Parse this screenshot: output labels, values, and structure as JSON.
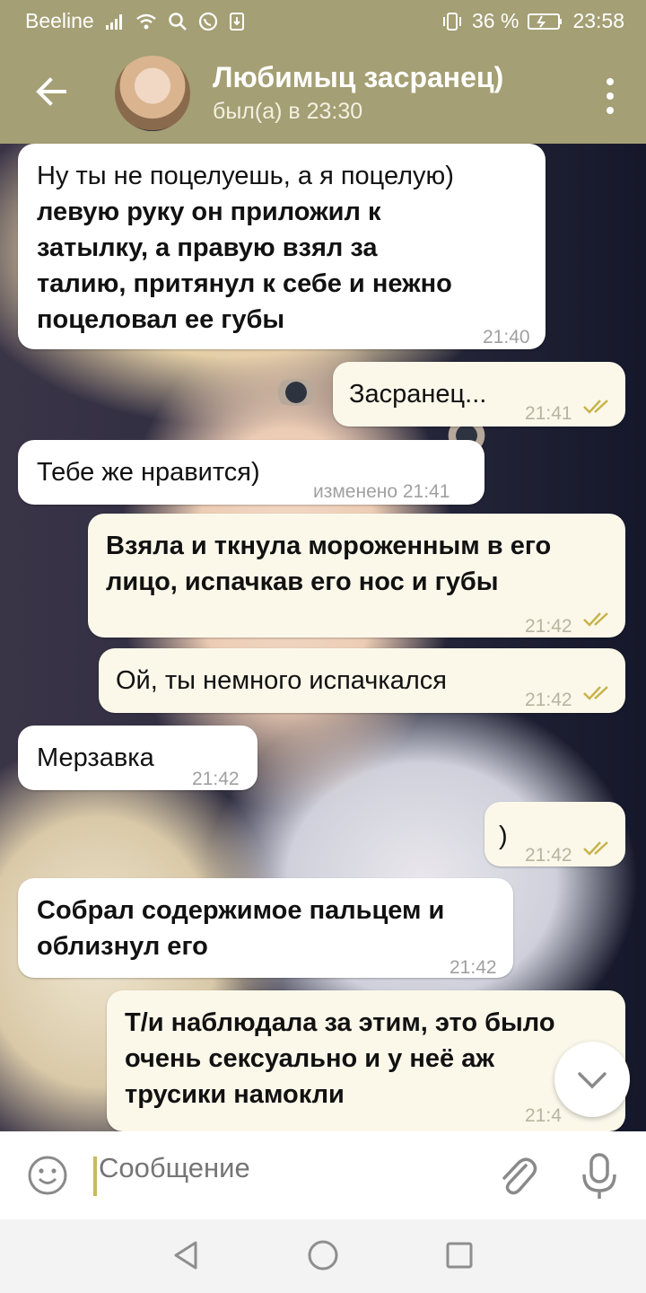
{
  "status_bar": {
    "carrier": "Beeline",
    "battery_percent": "36 %",
    "clock": "23:58",
    "icons": [
      "signal-icon",
      "wifi-icon",
      "search-icon",
      "whatsapp-icon",
      "download-icon",
      "vibrate-icon",
      "battery-icon"
    ]
  },
  "header": {
    "contact_name": "Любимыц засранец)",
    "last_seen": "был(а) в 23:30",
    "colors": {
      "bar": "#a49f74"
    }
  },
  "messages": [
    {
      "direction": "in",
      "bold": false,
      "lines": [
        "Ну ты не поцелуешь, а я поцелую)"
      ],
      "time": "21:40"
    },
    {
      "direction": "in",
      "bold": true,
      "lines": [
        "левую руку он приложил к",
        "затылку, а правую взял за",
        "талию, притянул к себе и нежно",
        "поцеловал ее губы"
      ]
    },
    {
      "direction": "out",
      "bold": false,
      "lines": [
        "Засранец..."
      ],
      "time": "21:41",
      "read": true
    },
    {
      "direction": "in",
      "bold": false,
      "lines": [
        "Тебе же нравится)"
      ],
      "time": "изменено 21:41"
    },
    {
      "direction": "out",
      "bold": true,
      "lines": [
        "Взяла и ткнула мороженным в его",
        "лицо, испачкав его нос и губы"
      ],
      "time": "21:42",
      "read": true
    },
    {
      "direction": "out",
      "bold": false,
      "lines": [
        "Ой, ты немного испачкался"
      ],
      "time": "21:42",
      "read": true
    },
    {
      "direction": "in",
      "bold": false,
      "lines": [
        "Мерзавка"
      ],
      "time": "21:42"
    },
    {
      "direction": "out",
      "bold": false,
      "lines": [
        ")"
      ],
      "time": "21:42",
      "read": true
    },
    {
      "direction": "in",
      "bold": true,
      "lines": [
        "Собрал содержимое пальцем и",
        "облизнул его"
      ],
      "time": "21:42"
    },
    {
      "direction": "out",
      "bold": true,
      "lines": [
        "Т/и наблюдала за этим, это было",
        "очень сексуально и у неё аж",
        "трусики намокли"
      ],
      "time": "21:4"
    }
  ],
  "composer": {
    "placeholder": "Сообщение"
  },
  "colors": {
    "incoming_bubble": "#ffffff",
    "outgoing_bubble": "#fbf8ea",
    "read_check": "#c8b34a"
  }
}
